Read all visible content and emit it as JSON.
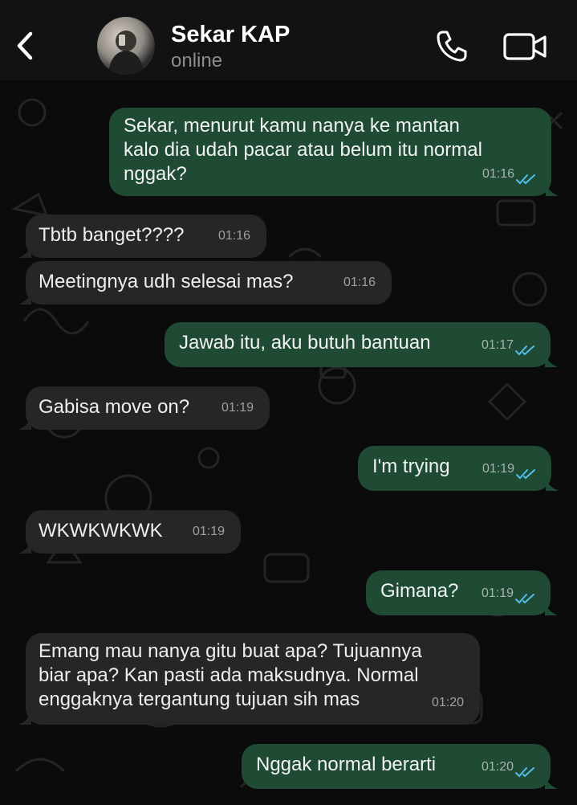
{
  "contact": {
    "name": "Sekar KAP",
    "status": "online"
  },
  "colors": {
    "outgoing": "#1f4a33",
    "incoming": "#262626",
    "read_ticks": "#53bdeb"
  },
  "icons": {
    "back": "chevron-left-icon",
    "call": "phone-icon",
    "video": "video-camera-icon"
  },
  "messages": [
    {
      "dir": "out",
      "lines": [
        "Sekar, menurut kamu nanya ke mantan",
        "kalo dia udah pacar atau belum itu normal",
        "nggak?"
      ],
      "time": "01:16",
      "read": true
    },
    {
      "dir": "in",
      "lines": [
        "Tbtb banget????"
      ],
      "time": "01:16"
    },
    {
      "dir": "in",
      "lines": [
        "Meetingnya udh selesai mas?"
      ],
      "time": "01:16"
    },
    {
      "dir": "out",
      "lines": [
        "Jawab itu, aku butuh bantuan"
      ],
      "time": "01:17",
      "read": true
    },
    {
      "dir": "in",
      "lines": [
        "Gabisa move on?"
      ],
      "time": "01:19"
    },
    {
      "dir": "out",
      "lines": [
        "I'm trying"
      ],
      "time": "01:19",
      "read": true
    },
    {
      "dir": "in",
      "lines": [
        "WKWKWKWK"
      ],
      "time": "01:19"
    },
    {
      "dir": "out",
      "lines": [
        "Gimana?"
      ],
      "time": "01:19",
      "read": true
    },
    {
      "dir": "in",
      "lines": [
        "Emang mau nanya gitu buat apa? Tujuannya",
        "biar apa? Kan pasti ada maksudnya. Normal",
        "enggaknya tergantung tujuan sih mas"
      ],
      "time": "01:20"
    },
    {
      "dir": "out",
      "lines": [
        "Nggak normal berarti"
      ],
      "time": "01:20",
      "read": true
    }
  ]
}
